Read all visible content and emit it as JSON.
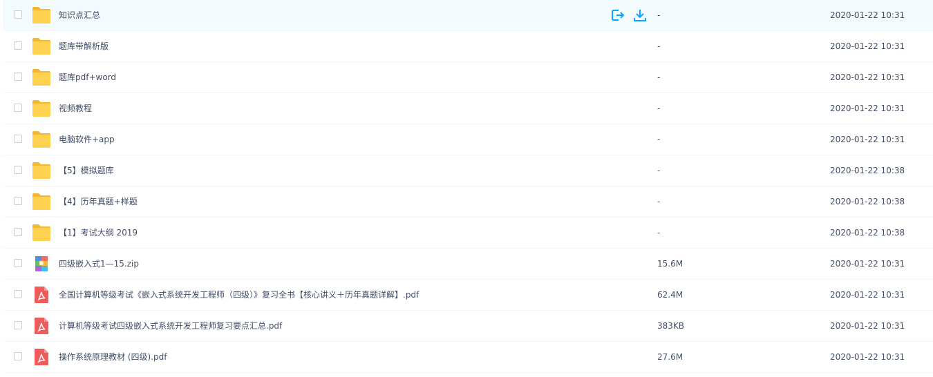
{
  "colors": {
    "accent": "#06a7ff",
    "folder": "#ffd150",
    "pdf": "#ee5b5b"
  },
  "rows": [
    {
      "name": "知识点汇总",
      "size": "-",
      "time": "2020-01-22 10:31",
      "icon": "folder-icon"
    },
    {
      "name": "题库带解析版",
      "size": "-",
      "time": "2020-01-22 10:31",
      "icon": "folder-icon"
    },
    {
      "name": "题库pdf+word",
      "size": "-",
      "time": "2020-01-22 10:31",
      "icon": "folder-icon"
    },
    {
      "name": "视频教程",
      "size": "-",
      "time": "2020-01-22 10:31",
      "icon": "folder-icon"
    },
    {
      "name": "电脑软件+app",
      "size": "-",
      "time": "2020-01-22 10:31",
      "icon": "folder-icon"
    },
    {
      "name": "【5】模拟题库",
      "size": "-",
      "time": "2020-01-22 10:38",
      "icon": "folder-icon"
    },
    {
      "name": "【4】历年真题+样题",
      "size": "-",
      "time": "2020-01-22 10:38",
      "icon": "folder-icon"
    },
    {
      "name": "【1】考试大纲 2019",
      "size": "-",
      "time": "2020-01-22 10:38",
      "icon": "folder-icon"
    },
    {
      "name": "四级嵌入式1—15.zip",
      "size": "15.6M",
      "time": "2020-01-22 10:31",
      "icon": "zip-icon"
    },
    {
      "name": "全国计算机等级考试《嵌入式系统开发工程师（四级）》复习全书【核心讲义＋历年真题详解】.pdf",
      "size": "62.4M",
      "time": "2020-01-22 10:31",
      "icon": "pdf-icon"
    },
    {
      "name": "计算机等级考试四级嵌入式系统开发工程师复习要点汇总.pdf",
      "size": "383KB",
      "time": "2020-01-22 10:31",
      "icon": "pdf-icon"
    },
    {
      "name": "操作系统原理教材 (四级).pdf",
      "size": "27.6M",
      "time": "2020-01-22 10:31",
      "icon": "pdf-icon"
    }
  ],
  "hover_actions": {
    "share_icon": "share-icon",
    "download_icon": "download-icon"
  }
}
